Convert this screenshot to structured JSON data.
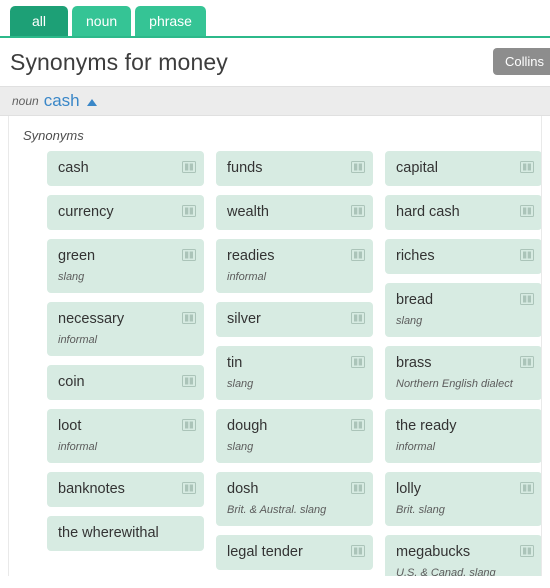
{
  "tabs": [
    {
      "label": "all",
      "active": true
    },
    {
      "label": "noun",
      "active": false
    },
    {
      "label": "phrase",
      "active": false
    }
  ],
  "header": {
    "title": "Synonyms for money",
    "source_badge": "Collins"
  },
  "sense": {
    "part_of_speech": "noun",
    "word": "cash",
    "collapse_icon": "caret-up-icon"
  },
  "group_label": "Synonyms",
  "icons": {
    "dictionary": "book-icon"
  },
  "colors": {
    "tab_active": "#1da076",
    "tab_inactive": "#35c495",
    "tab_underline": "#2cb98a",
    "card_bg": "#d7ebe2",
    "sense_word": "#3a87c8",
    "badge_bg": "#8d8d8d"
  },
  "columns": [
    {
      "cards": [
        {
          "word": "cash",
          "label": "",
          "has_book": true
        },
        {
          "word": "currency",
          "label": "",
          "has_book": true
        },
        {
          "word": "green",
          "label": "slang",
          "has_book": true
        },
        {
          "word": "necessary",
          "label": "informal",
          "has_book": true
        },
        {
          "word": "coin",
          "label": "",
          "has_book": true
        },
        {
          "word": "loot",
          "label": "informal",
          "has_book": true
        },
        {
          "word": "banknotes",
          "label": "",
          "has_book": true
        },
        {
          "word": "the wherewithal",
          "label": "",
          "has_book": false
        }
      ]
    },
    {
      "cards": [
        {
          "word": "funds",
          "label": "",
          "has_book": true
        },
        {
          "word": "wealth",
          "label": "",
          "has_book": true
        },
        {
          "word": "readies",
          "label": "informal",
          "has_book": true
        },
        {
          "word": "silver",
          "label": "",
          "has_book": true
        },
        {
          "word": "tin",
          "label": "slang",
          "has_book": true
        },
        {
          "word": "dough",
          "label": "slang",
          "has_book": true
        },
        {
          "word": "dosh",
          "label": "Brit. & Austral. slang",
          "has_book": true
        },
        {
          "word": "legal tender",
          "label": "",
          "has_book": true
        }
      ]
    },
    {
      "cards": [
        {
          "word": "capital",
          "label": "",
          "has_book": true
        },
        {
          "word": "hard cash",
          "label": "",
          "has_book": true
        },
        {
          "word": "riches",
          "label": "",
          "has_book": true
        },
        {
          "word": "bread",
          "label": "slang",
          "has_book": true
        },
        {
          "word": "brass",
          "label": "Northern English dialect",
          "has_book": true
        },
        {
          "word": "the ready",
          "label": "informal",
          "has_book": false
        },
        {
          "word": "lolly",
          "label": "Brit. slang",
          "has_book": true
        },
        {
          "word": "megabucks",
          "label": "U.S. & Canad. slang",
          "has_book": true
        }
      ]
    }
  ]
}
